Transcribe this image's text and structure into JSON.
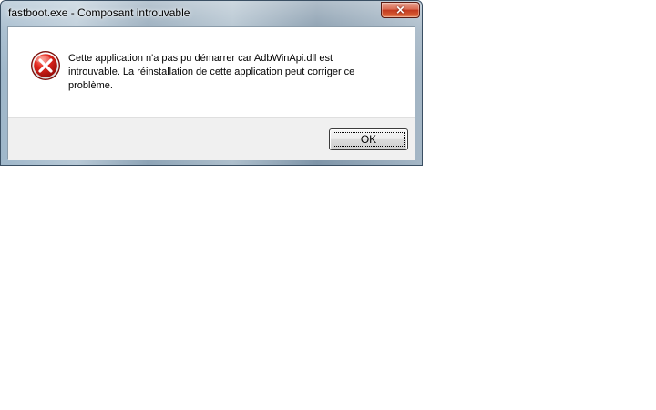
{
  "window": {
    "title": "fastboot.exe - Composant introuvable",
    "close_symbol": "×",
    "accent_color": "#c2391f"
  },
  "dialog": {
    "message_lines": [
      "Cette application n'a pas pu démarrer car AdbWinApi.dll est",
      "introuvable. La réinstallation de cette application peut corriger ce",
      "problème."
    ],
    "icon": "error-icon",
    "ok_label": "OK"
  }
}
